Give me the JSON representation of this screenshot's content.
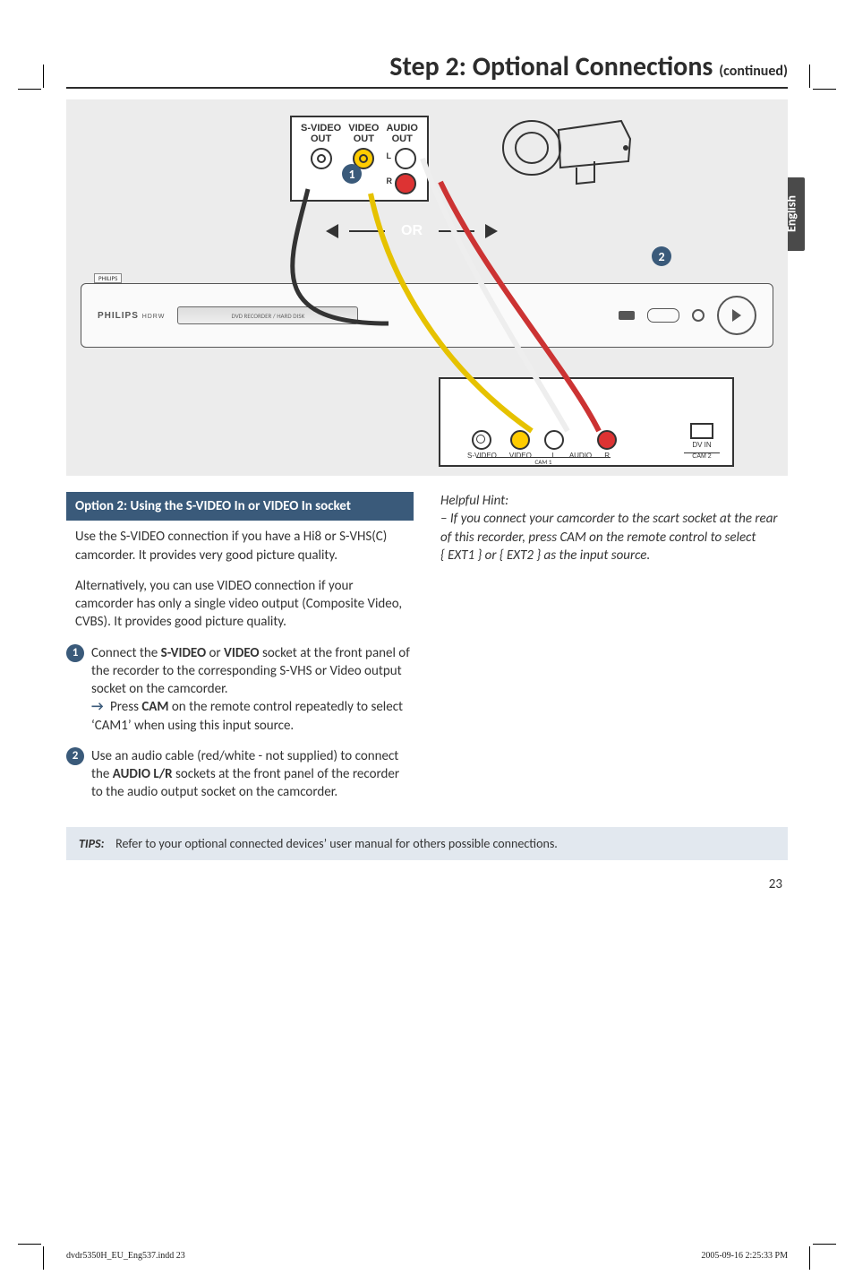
{
  "crop_marks": true,
  "heading": {
    "main": "Step 2: Optional Connections",
    "cont": "(continued)"
  },
  "language_tab": "English",
  "figure": {
    "panel": {
      "svideo_label_line1": "S-VIDEO",
      "svideo_label_line2": "OUT",
      "video_label_line1": "VIDEO",
      "video_label_line2": "OUT",
      "audio_label_line1": "AUDIO",
      "audio_label_line2": "OUT",
      "l_label": "L",
      "r_label": "R"
    },
    "badge1": "1",
    "or_label": "OR",
    "badge2": "2",
    "device": {
      "brand": "PHILIPS",
      "subbrand": "HDRW",
      "slot_text": "DVD RECORDER / HARD DISK",
      "flap_brand": "PHILIPS"
    },
    "front_panel": {
      "svideo": "S-VIDEO",
      "video": "VIDEO",
      "l": "L",
      "audio": "AUDIO",
      "r": "R",
      "dvin": "DV IN",
      "cam1": "CAM 1",
      "cam2": "CAM 2"
    }
  },
  "left_column": {
    "section_header": "Option 2: Using the S-VIDEO In or VIDEO In socket",
    "para1": "Use the S-VIDEO connection if you have a Hi8 or S-VHS(C) camcorder. It provides very good picture quality.",
    "para2": "Alternatively, you can use VIDEO connection if your camcorder has only a single video output (Composite Video, CVBS). It provides good picture quality.",
    "step1": {
      "num": "1",
      "pre": "Connect the ",
      "kw1": "S-VIDEO",
      "mid1": " or ",
      "kw2": "VIDEO",
      "post1": " socket at the front panel of the recorder to the corresponding S-VHS or Video output socket on the camcorder.",
      "arrow": "→",
      "press_pre": " Press ",
      "cam_kw": "CAM",
      "press_post": " on the remote control repeatedly to select ‘CAM1’ when using this input source."
    },
    "step2": {
      "num": "2",
      "pre": "Use an audio cable (red/white - not supplied) to connect the ",
      "kw": "AUDIO L/R",
      "post": " sockets at the front panel of the recorder to the audio output socket on the camcorder."
    }
  },
  "right_column": {
    "hint_label": "Helpful Hint:",
    "hint_body_pre": "– If you connect your camcorder to the scart socket at the rear of this recorder, press CAM on the remote control to select ",
    "ext1": "{ EXT1 }",
    "hint_or": " or ",
    "ext2": "{ EXT2 }",
    "hint_body_post": " as the input source."
  },
  "tips": {
    "label": "TIPS:",
    "body": "Refer to your optional connected devices’ user manual for others possible connections."
  },
  "page_number": "23",
  "footer": {
    "left": "dvdr5350H_EU_Eng537.indd   23",
    "right": "2005-09-16   2:25:33 PM"
  }
}
